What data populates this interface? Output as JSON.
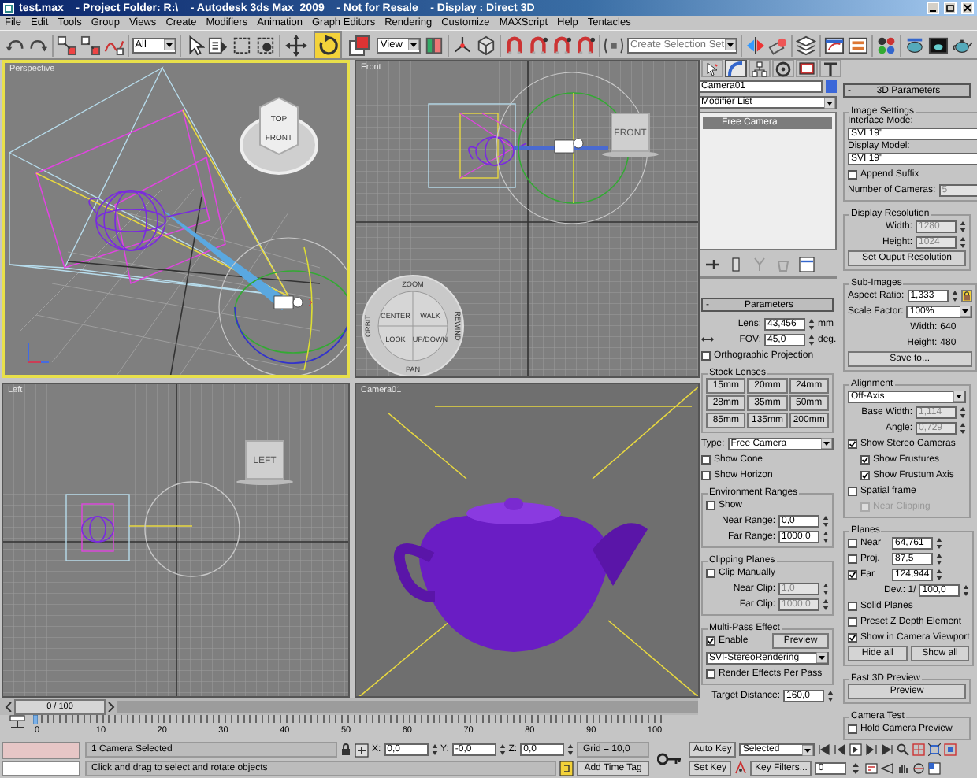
{
  "title_bar": {
    "text": "test.max    - Project Folder: R:\\    - Autodesk 3ds Max  2009    - Not for Resale    - Display : Direct 3D"
  },
  "menu": [
    "File",
    "Edit",
    "Tools",
    "Group",
    "Views",
    "Create",
    "Modifiers",
    "Animation",
    "Graph Editors",
    "Rendering",
    "Customize",
    "MAXScript",
    "Help",
    "Tentacles"
  ],
  "toolbar": {
    "selection_filter": "All",
    "reference_coordinate": "View",
    "named_selection_placeholder": "Create Selection Set",
    "transform_tools": [
      {
        "selected": false
      },
      {
        "selected": true
      },
      {
        "selected": false
      }
    ]
  },
  "viewports": [
    {
      "kind": "perspective",
      "label": "Perspective",
      "active": true,
      "viewcube": [
        "TOP",
        "FRONT"
      ]
    },
    {
      "kind": "front",
      "label": "Front",
      "active": false,
      "viewcube": [
        "FRONT"
      ],
      "wheel": [
        "ZOOM",
        "CENTER",
        "WALK",
        "ORBIT",
        "REWIND",
        "LOOK",
        "UP/DOWN",
        "PAN"
      ]
    },
    {
      "kind": "left",
      "label": "Left",
      "active": false,
      "viewcube": [
        "LEFT"
      ]
    },
    {
      "kind": "camera",
      "label": "Camera01",
      "active": false
    }
  ],
  "time_slider": {
    "label": "0 / 100"
  },
  "track_bar": {
    "ticks": [
      "0",
      "10",
      "20",
      "30",
      "40",
      "50",
      "60",
      "70",
      "80",
      "90",
      "100"
    ]
  },
  "command_panel": {
    "tabs": [
      {
        "selected": false
      },
      {
        "selected": true
      },
      {
        "selected": false
      },
      {
        "selected": false
      },
      {
        "selected": false
      },
      {
        "selected": false
      }
    ],
    "object_name": "Camera01",
    "modifier_list": "Modifier List",
    "stack": [
      {
        "label": "Free Camera",
        "selected": true
      }
    ],
    "parameters": {
      "toggle": "-",
      "title": "Parameters",
      "rows": [
        {
          "kind": "spinner",
          "label": "Lens:",
          "value": "43,456",
          "unit": "mm",
          "disabled": false
        },
        {
          "kind": "fov_spinner",
          "label": "FOV:",
          "value": "45,0",
          "unit": "deg.",
          "disabled": false
        },
        {
          "kind": "check",
          "label": "Orthographic Projection",
          "checked": false,
          "disabled": false
        },
        {
          "kind": "group",
          "title": "Stock Lenses",
          "rows": [
            {
              "kind": "grid",
              "buttons": [
                "15mm",
                "20mm",
                "24mm",
                "28mm",
                "35mm",
                "50mm",
                "85mm",
                "135mm",
                "200mm"
              ]
            }
          ]
        },
        {
          "kind": "dropdown",
          "label": "Type:",
          "value": "Free Camera"
        },
        {
          "kind": "check",
          "label": "Show Cone",
          "checked": false,
          "disabled": false
        },
        {
          "kind": "check",
          "label": "Show Horizon",
          "checked": false,
          "disabled": false
        },
        {
          "kind": "group",
          "title": "Environment Ranges",
          "rows": [
            {
              "kind": "check",
              "label": "Show",
              "checked": false,
              "disabled": false
            },
            {
              "kind": "spinner",
              "label": "Near Range:",
              "value": "0,0",
              "disabled": false
            },
            {
              "kind": "spinner",
              "label": "Far Range:",
              "value": "1000,0",
              "disabled": false
            }
          ]
        },
        {
          "kind": "group",
          "title": "Clipping Planes",
          "rows": [
            {
              "kind": "check",
              "label": "Clip Manually",
              "checked": false,
              "disabled": false
            },
            {
              "kind": "spinner",
              "label": "Near Clip:",
              "value": "1,0",
              "disabled": true
            },
            {
              "kind": "spinner",
              "label": "Far Clip:",
              "value": "1000,0",
              "disabled": true
            }
          ]
        },
        {
          "kind": "group",
          "title": "Multi-Pass Effect",
          "rows": [
            {
              "kind": "check_button",
              "label": "Enable",
              "checked": true,
              "disabled": false,
              "button": "Preview"
            },
            {
              "kind": "dropdown",
              "value": "SVI-StereoRendering"
            },
            {
              "kind": "check",
              "label": "Render Effects Per Pass",
              "checked": false,
              "disabled": false
            }
          ]
        },
        {
          "kind": "spinner",
          "label": "Target Distance:",
          "value": "160,0",
          "disabled": false
        }
      ]
    },
    "stereo": {
      "toggle": "-",
      "title": "3D Parameters",
      "rows": [
        {
          "kind": "group",
          "title": "Image Settings",
          "rows": [
            {
              "kind": "labeled_dropdown",
              "label": "Interlace Mode:",
              "value": "SVI 19\""
            },
            {
              "kind": "labeled_dropdown",
              "label": "Display Model:",
              "value": "SVI 19\""
            },
            {
              "kind": "check",
              "label": "Append Suffix",
              "checked": false,
              "disabled": false
            },
            {
              "kind": "spinner",
              "label": "Number of Cameras:",
              "value": "5",
              "disabled": true
            }
          ]
        },
        {
          "kind": "group",
          "title": "Display Resolution",
          "rows": [
            {
              "kind": "spinner",
              "label": "Width:",
              "value": "1280",
              "disabled": true
            },
            {
              "kind": "spinner",
              "label": "Height:",
              "value": "1024",
              "disabled": true
            },
            {
              "kind": "button",
              "label": "Set Ouput Resolution"
            }
          ]
        },
        {
          "kind": "group",
          "title": "Sub-Images",
          "rows": [
            {
              "kind": "spinner_lock",
              "label": "Aspect Ratio:",
              "value": "1,333",
              "disabled": false,
              "locked": true
            },
            {
              "kind": "dropdown",
              "label": "Scale Factor:",
              "value": "100%"
            },
            {
              "kind": "info",
              "label": "Width:",
              "value": "640"
            },
            {
              "kind": "info",
              "label": "Height:",
              "value": "480"
            },
            {
              "kind": "button",
              "label": "Save to..."
            }
          ]
        },
        {
          "kind": "group",
          "title": "Alignment",
          "rows": [
            {
              "kind": "dropdown",
              "value": "Off-Axis"
            },
            {
              "kind": "spinner",
              "label": "Base Width:",
              "value": "1,114",
              "disabled": true
            },
            {
              "kind": "spinner",
              "label": "Angle:",
              "value": "0,729",
              "disabled": true
            },
            {
              "kind": "check",
              "label": "Show Stereo Cameras",
              "checked": true,
              "disabled": false,
              "children": [
                {
                  "kind": "check",
                  "label": "Show Frustures",
                  "checked": true,
                  "disabled": false
                },
                {
                  "kind": "check",
                  "label": "Show Frustum Axis",
                  "checked": true,
                  "disabled": false
                }
              ]
            },
            {
              "kind": "check",
              "label": "Spatial frame",
              "checked": false,
              "disabled": false,
              "children": [
                {
                  "kind": "check",
                  "label": "Near Clipping",
                  "checked": false,
                  "disabled": true
                }
              ]
            }
          ]
        },
        {
          "kind": "group",
          "title": "Planes",
          "rows": [
            {
              "kind": "check_spinner",
              "label": "Near",
              "value": "64,761",
              "checked": false,
              "disabled": false
            },
            {
              "kind": "check_spinner",
              "label": "Proj.",
              "value": "87,5",
              "checked": false,
              "disabled": false
            },
            {
              "kind": "check_spinner",
              "label": "Far",
              "value": "124,944",
              "checked": true,
              "disabled": false
            },
            {
              "kind": "spinner",
              "label": "Dev.: 1/",
              "value": "100,0",
              "disabled": false
            },
            {
              "kind": "check",
              "label": "Solid Planes",
              "checked": false,
              "disabled": false
            },
            {
              "kind": "check",
              "label": "Preset Z Depth Element",
              "checked": false,
              "disabled": false
            },
            {
              "kind": "check",
              "label": "Show in Camera Viewport",
              "checked": true,
              "disabled": false
            },
            {
              "kind": "button_row",
              "buttons": [
                "Hide all",
                "Show all"
              ]
            }
          ]
        },
        {
          "kind": "group",
          "title": "Fast 3D Preview",
          "rows": [
            {
              "kind": "button",
              "label": "Preview"
            }
          ]
        },
        {
          "kind": "group",
          "title": "Camera Test",
          "rows": [
            {
              "kind": "check",
              "label": "Hold Camera Preview",
              "checked": false,
              "disabled": false
            }
          ]
        }
      ]
    }
  },
  "status": {
    "selection": "1 Camera Selected",
    "prompt": "Click and drag to select and rotate objects",
    "coordinates": [
      {
        "axis": "X:",
        "value": "0,0"
      },
      {
        "axis": "Y:",
        "value": "-0,0"
      },
      {
        "axis": "Z:",
        "value": "0,0"
      }
    ],
    "grid": "Grid = 10,0",
    "time_tag": "Add Time Tag"
  },
  "animation": {
    "auto_key": "Auto Key",
    "key_mode": "Selected",
    "set_key": "Set Key",
    "key_filters": "Key Filters...",
    "frame": "0"
  }
}
